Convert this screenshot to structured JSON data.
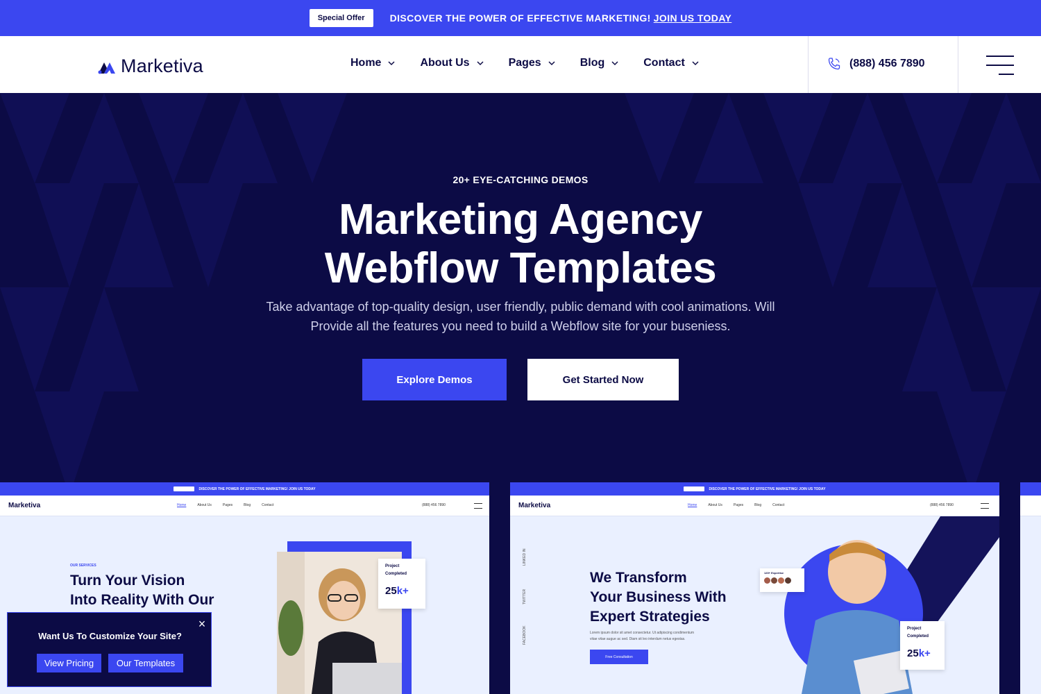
{
  "topbar": {
    "badge": "Special Offer",
    "message": "DISCOVER THE POWER OF EFFECTIVE MARKETING!",
    "link": "JOIN US TODAY"
  },
  "header": {
    "logo": "Marketiva",
    "nav": [
      "Home",
      "About Us",
      "Pages",
      "Blog",
      "Contact"
    ],
    "phone": "(888) 456 7890"
  },
  "hero": {
    "eyebrow": "20+ EYE-CATCHING DEMOS",
    "title_line1": "Marketing Agency",
    "title_line2": "Webflow Templates",
    "description_line1": "Take advantage of top-quality design, user friendly, public demand with cool animations. Will",
    "description_line2": "Provide all the features you need to build a Webflow site for your buseniess.",
    "primary_button": "Explore Demos",
    "secondary_button": "Get Started Now"
  },
  "demo1": {
    "logo": "Marketiva",
    "top_text": "DISCOVER THE POWER OF EFFECTIVE MARKETING! JOIN US TODAY",
    "nav": [
      "Home",
      "About Us",
      "Pages",
      "Blog",
      "Contact"
    ],
    "phone": "(888) 456 7890",
    "eyebrow": "OUR SERVICES",
    "heading_line1": "Turn Your Vision",
    "heading_line2": "Into Reality With Our",
    "stat_label_line1": "Project",
    "stat_label_line2": "Completed",
    "stat_value": "25",
    "stat_suffix": "k+"
  },
  "demo2": {
    "logo": "Marketiva",
    "top_text": "DISCOVER THE POWER OF EFFECTIVE MARKETING! JOIN US TODAY",
    "nav": [
      "Home",
      "About Us",
      "Pages",
      "Blog",
      "Contact"
    ],
    "phone": "(888) 456 7890",
    "social": [
      "LINKED IN",
      "TWITTER",
      "FACEBOOK"
    ],
    "heading_line1": "We Transform",
    "heading_line2": "Your Business With",
    "heading_line3": "Expert Strategies",
    "body_line1": "Lorem ipsum dolor sit amet consectetur. Ut adipiscing condimentum",
    "body_line2": "vitae vitae augue ac sed. Diam sit leo interdum netus egestas.",
    "button": "Free Consultation",
    "expertise": "120+ Expertise",
    "stat_label_line1": "Project",
    "stat_label_line2": "Completed",
    "stat_value": "25",
    "stat_suffix": "k+"
  },
  "popup": {
    "title": "Want Us To Customize Your Site?",
    "button1": "View Pricing",
    "button2": "Our Templates",
    "close": "×"
  },
  "colors": {
    "brand_blue": "#3b47f0",
    "navy": "#0c0b45"
  }
}
